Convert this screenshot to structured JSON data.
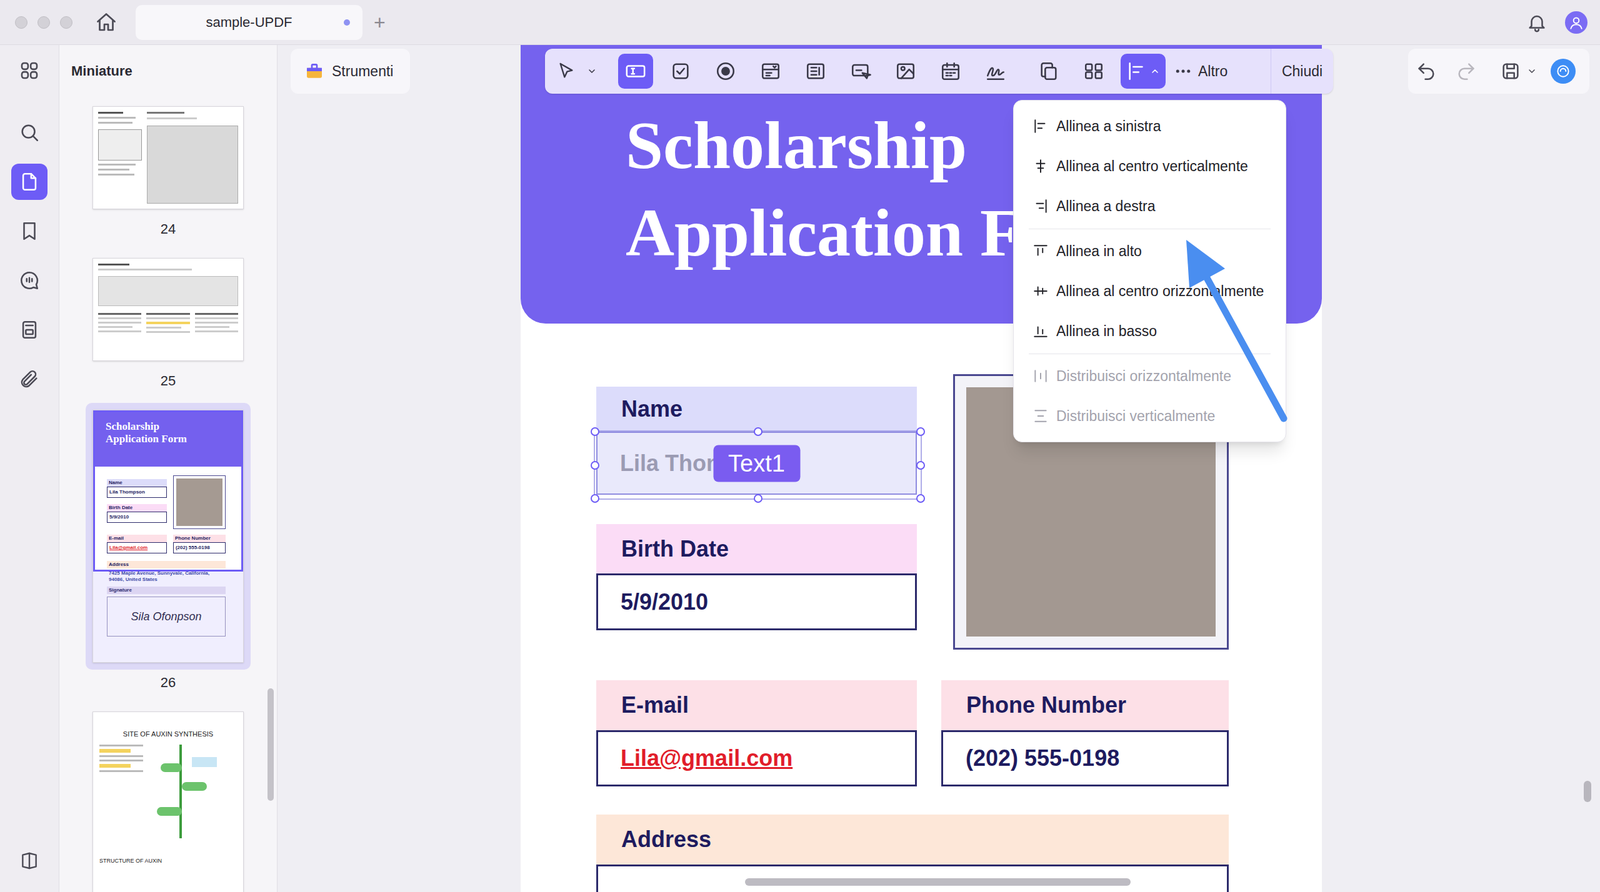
{
  "window": {
    "tab_title": "sample-UPDF",
    "tab_unsaved": true,
    "new_tab": "+"
  },
  "rail": {
    "items": [
      {
        "selected": false
      },
      {
        "selected": false
      },
      {
        "selected": true
      },
      {
        "selected": false
      },
      {
        "selected": false
      },
      {
        "selected": false
      },
      {
        "selected": false
      }
    ],
    "bottom_item": {
      "selected": false
    }
  },
  "thumbnails": {
    "title": "Miniature",
    "pages": [
      {
        "number": "24",
        "kind": "sketch",
        "selected": false
      },
      {
        "number": "25",
        "kind": "plans",
        "selected": false
      },
      {
        "number": "26",
        "kind": "form",
        "selected": true
      },
      {
        "kind": "diagram",
        "selected": false
      }
    ]
  },
  "thumbnail_form": {
    "title": "Scholarship Application Form",
    "name_label": "Name",
    "name": "Lila Thompson",
    "birth_label": "Birth Date",
    "birth": "5/9/2010",
    "email_label": "E-mail",
    "email": "Lila@gmail.com",
    "phone_label": "Phone Number",
    "phone": "(202) 555-0198",
    "address_label": "Address",
    "address": "7425 Maple Avenue, Sunnyvale, California, 94086, United States",
    "signature_label": "Signature",
    "signature": "Sila Ofonpson"
  },
  "thumbnail_diagram": {
    "title": "SITE OF AUXIN SYNTHESIS",
    "subtitle": "STRUCTURE OF AUXIN"
  },
  "tools_button": {
    "label": "Strumenti"
  },
  "toolbar": {
    "tools": [
      {
        "selected": false
      },
      {
        "selected": true
      },
      {
        "selected": false
      },
      {
        "selected": false
      },
      {
        "selected": false
      },
      {
        "selected": false
      },
      {
        "selected": false
      },
      {
        "selected": false
      },
      {
        "selected": false
      },
      {
        "selected": false
      },
      {
        "selected": false
      },
      {
        "selected": false
      },
      {
        "selected": true,
        "expanded": true
      }
    ],
    "more": "Altro",
    "close": "Chiudi"
  },
  "align_menu": {
    "open": true,
    "groups": [
      [
        {
          "label": "Allinea a sinistra",
          "disabled": false
        },
        {
          "label": "Allinea al centro verticalmente",
          "disabled": false
        },
        {
          "label": "Allinea a destra",
          "disabled": false
        }
      ],
      [
        {
          "label": "Allinea in alto",
          "disabled": false
        },
        {
          "label": "Allinea al centro orizzontalmente",
          "disabled": false
        },
        {
          "label": "Allinea in basso",
          "disabled": false
        }
      ],
      [
        {
          "label": "Distribuisci orizzontalmente",
          "disabled": true
        },
        {
          "label": "Distribuisci verticalmente",
          "disabled": true
        }
      ]
    ]
  },
  "document": {
    "title_lines": [
      "Scholarship",
      "Application F"
    ],
    "name": {
      "label": "Name",
      "value": "Lila Thom",
      "selected": true
    },
    "birth_date": {
      "label": "Birth Date",
      "value": "5/9/2010",
      "selected": false
    },
    "email": {
      "label": "E-mail",
      "value": "Lila@gmail.com",
      "selected": false,
      "kind": "link"
    },
    "phone": {
      "label": "Phone Number",
      "value": "(202) 555-0198",
      "selected": false
    },
    "address": {
      "label": "Address"
    }
  },
  "selection_badge": "Text1"
}
